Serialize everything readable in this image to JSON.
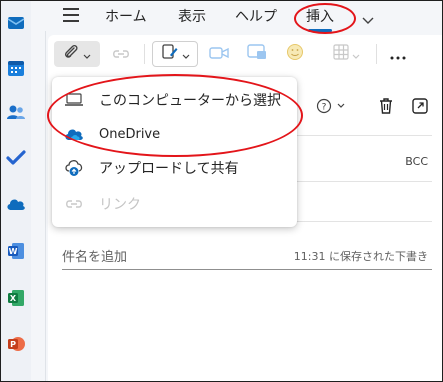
{
  "ribbon": {
    "tabs": [
      {
        "label": "ホーム"
      },
      {
        "label": "表示"
      },
      {
        "label": "ヘルプ"
      },
      {
        "label": "挿入"
      }
    ]
  },
  "attach_menu": {
    "items": [
      {
        "label": "このコンピューターから選択",
        "icon": "laptop-icon",
        "enabled": true
      },
      {
        "label": "OneDrive",
        "icon": "onedrive-cloud-icon",
        "enabled": true
      },
      {
        "label": "アップロードして共有",
        "icon": "cloud-upload-icon",
        "enabled": true
      },
      {
        "label": "リンク",
        "icon": "link-icon",
        "enabled": false
      }
    ]
  },
  "compose": {
    "bcc_label": "BCC",
    "subject_placeholder": "件名を追加",
    "draft_status": "11:31 に保存された下書き"
  },
  "colors": {
    "accent": "#0f6cbd",
    "annotation": "#e3151a"
  }
}
